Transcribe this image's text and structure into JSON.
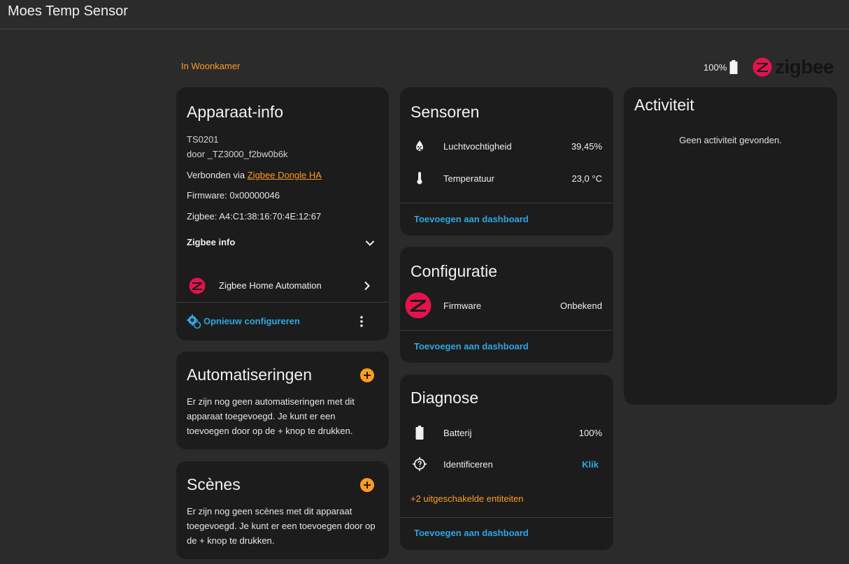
{
  "header": {
    "title": "Moes Temp Sensor"
  },
  "area": {
    "label": "In Woonkamer"
  },
  "battery": {
    "level": "100%"
  },
  "brand": {
    "logo_text": "zigbee",
    "color": "#e5124d"
  },
  "device_info": {
    "title": "Apparaat-info",
    "model": "TS0201",
    "manufacturer": "door _TZ3000_f2bw0b6k",
    "connected_via_prefix": "Verbonden via ",
    "connected_via_link": "Zigbee Dongle HA",
    "firmware": "Firmware: 0x00000046",
    "zigbee": "Zigbee: A4:C1:38:16:70:4E:12:67",
    "zigbee_info_label": "Zigbee info",
    "integration_label": "Zigbee Home Automation",
    "reconfigure_label": "Opnieuw configureren"
  },
  "automations": {
    "title": "Automatiseringen",
    "body": "Er zijn nog geen automatiseringen met dit apparaat toegevoegd. Je kunt er een toevoegen door op de + knop te drukken."
  },
  "scenes": {
    "title": "Scènes",
    "body": "Er zijn nog geen scènes met dit apparaat toegevoegd. Je kunt er een toevoegen door op de + knop te drukken."
  },
  "sensors": {
    "title": "Sensoren",
    "items": [
      {
        "name": "Luchtvochtigheid",
        "value": "39,45%",
        "icon": "water-percent-icon"
      },
      {
        "name": "Temperatuur",
        "value": "23,0 °C",
        "icon": "thermometer-icon"
      }
    ],
    "add_label": "Toevoegen aan dashboard"
  },
  "configuration": {
    "title": "Configuratie",
    "items": [
      {
        "name": "Firmware",
        "value": "Onbekend",
        "icon": "zigbee-icon"
      }
    ],
    "add_label": "Toevoegen aan dashboard"
  },
  "diagnostics": {
    "title": "Diagnose",
    "items": [
      {
        "name": "Batterij",
        "value": "100%",
        "icon": "battery-icon"
      },
      {
        "name": "Identificeren",
        "value": "Klik",
        "icon": "crosshairs-question-icon"
      }
    ],
    "disabled_label": "+2 uitgeschakelde entiteiten",
    "add_label": "Toevoegen aan dashboard"
  },
  "activity": {
    "title": "Activiteit",
    "empty": "Geen activiteit gevonden."
  },
  "colors": {
    "accent": "#ff9b21",
    "link_blue": "#2fa6e0",
    "card_bg": "#1c1c1c",
    "page_bg": "#2b2b2b"
  }
}
